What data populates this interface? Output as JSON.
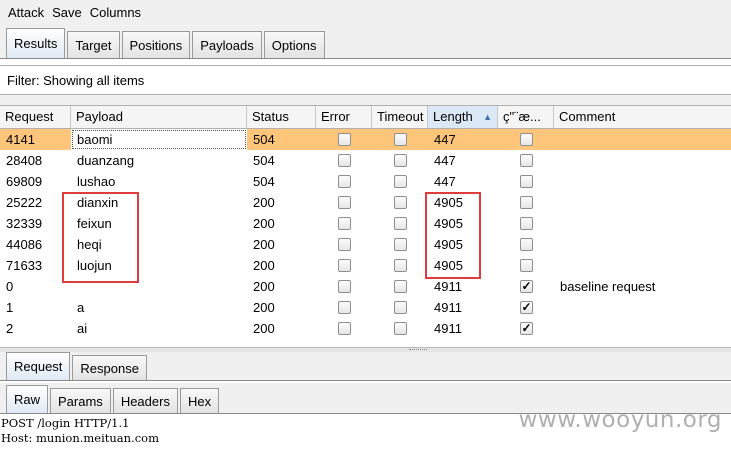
{
  "menu": [
    "Attack",
    "Save",
    "Columns"
  ],
  "main_tabs": [
    "Results",
    "Target",
    "Positions",
    "Payloads",
    "Options"
  ],
  "filter_text": "Filter: Showing all items",
  "columns": [
    "Request",
    "Payload",
    "Status",
    "Error",
    "Timeout",
    "Length",
    "ç\"¨æ...",
    "Comment"
  ],
  "sorted_column": "Length",
  "rows": [
    {
      "request": "4141",
      "payload": "baomi",
      "status": "504",
      "error": false,
      "timeout": false,
      "length": "447",
      "marked": false,
      "comment": ""
    },
    {
      "request": "28408",
      "payload": "duanzang",
      "status": "504",
      "error": false,
      "timeout": false,
      "length": "447",
      "marked": false,
      "comment": ""
    },
    {
      "request": "69809",
      "payload": "lushao",
      "status": "504",
      "error": false,
      "timeout": false,
      "length": "447",
      "marked": false,
      "comment": ""
    },
    {
      "request": "25222",
      "payload": "dianxin",
      "status": "200",
      "error": false,
      "timeout": false,
      "length": "4905",
      "marked": false,
      "comment": ""
    },
    {
      "request": "32339",
      "payload": "feixun",
      "status": "200",
      "error": false,
      "timeout": false,
      "length": "4905",
      "marked": false,
      "comment": ""
    },
    {
      "request": "44086",
      "payload": "heqi",
      "status": "200",
      "error": false,
      "timeout": false,
      "length": "4905",
      "marked": false,
      "comment": ""
    },
    {
      "request": "71633",
      "payload": "luojun",
      "status": "200",
      "error": false,
      "timeout": false,
      "length": "4905",
      "marked": false,
      "comment": ""
    },
    {
      "request": "0",
      "payload": "",
      "status": "200",
      "error": false,
      "timeout": false,
      "length": "4911",
      "marked": true,
      "comment": "baseline request"
    },
    {
      "request": "1",
      "payload": "a",
      "status": "200",
      "error": false,
      "timeout": false,
      "length": "4911",
      "marked": true,
      "comment": ""
    },
    {
      "request": "2",
      "payload": "ai",
      "status": "200",
      "error": false,
      "timeout": false,
      "length": "4911",
      "marked": true,
      "comment": ""
    }
  ],
  "req_tabs": [
    "Request",
    "Response"
  ],
  "view_tabs": [
    "Raw",
    "Params",
    "Headers",
    "Hex"
  ],
  "raw_lines": [
    "POST /login HTTP/1.1",
    "Host: munion.meituan.com"
  ],
  "watermark": "www.wooyun.org",
  "colors": {
    "selected_row": "#ffc57a",
    "highlight_box": "#e03c3c"
  }
}
